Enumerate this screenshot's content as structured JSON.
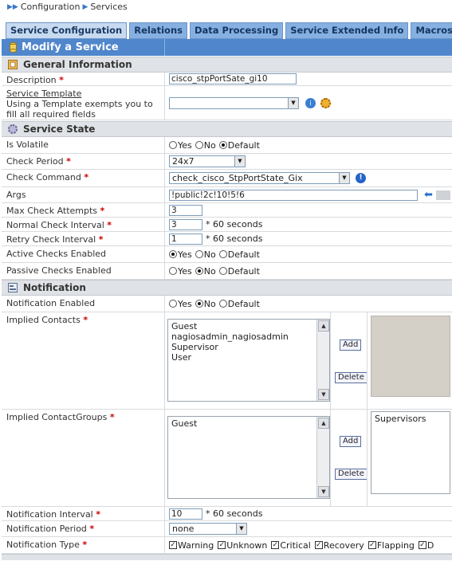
{
  "breadcrumb": {
    "root": "Configuration",
    "current": "Services"
  },
  "tabs": [
    "Service Configuration",
    "Relations",
    "Data Processing",
    "Service Extended Info",
    "Macros"
  ],
  "header": {
    "title": "Modify a Service"
  },
  "sections": {
    "general": "General Information",
    "state": "Service State",
    "notification": "Notification"
  },
  "general": {
    "description_label": "Description",
    "description_value": "cisco_stpPortSate_gi10",
    "template_label": "Service Template",
    "template_help": "Using a Template exempts you to fill all required fields",
    "template_value": ""
  },
  "state": {
    "volatile_label": "Is Volatile",
    "check_period_label": "Check Period",
    "check_period_value": "24x7",
    "check_command_label": "Check Command",
    "check_command_value": "check_cisco_StpPortState_Gix",
    "args_label": "Args",
    "args_value": "!public!2c!10!5!6",
    "max_attempts_label": "Max Check Attempts",
    "max_attempts_value": "3",
    "normal_interval_label": "Normal Check Interval",
    "normal_interval_value": "3",
    "retry_interval_label": "Retry Check Interval",
    "retry_interval_value": "1",
    "interval_unit": "* 60 seconds",
    "active_label": "Active Checks Enabled",
    "passive_label": "Passive Checks Enabled"
  },
  "radio": {
    "yes": "Yes",
    "no": "No",
    "default": "Default"
  },
  "notification": {
    "enabled_label": "Notification Enabled",
    "contacts_label": "Implied Contacts",
    "contacts": [
      "Guest",
      "nagiosadmin_nagiosadmin",
      "Supervisor",
      "User"
    ],
    "contactgroups_label": "Implied ContactGroups",
    "contactgroups": [
      "Guest"
    ],
    "contactgroups_selected": [
      "Supervisors"
    ],
    "add_label": "Add",
    "delete_label": "Delete",
    "interval_label": "Notification Interval",
    "interval_value": "10",
    "interval_unit": "* 60 seconds",
    "period_label": "Notification Period",
    "period_value": "none",
    "type_label": "Notification Type",
    "types": [
      "Warning",
      "Unknown",
      "Critical",
      "Recovery",
      "Flapping",
      "D"
    ]
  },
  "colors": {
    "tab": "#86b0e2",
    "header": "#4f86cc",
    "section": "#dfe2e6",
    "required": "#cc0000"
  }
}
